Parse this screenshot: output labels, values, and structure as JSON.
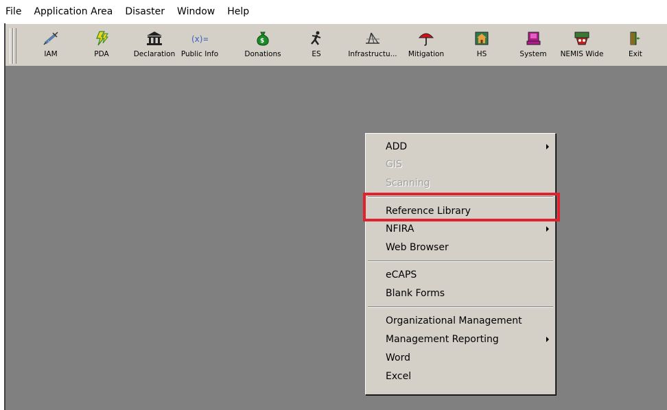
{
  "menubar": {
    "items": [
      "File",
      "Application Area",
      "Disaster",
      "Window",
      "Help"
    ]
  },
  "toolbar": {
    "buttons": [
      {
        "label": "IAM",
        "icon": "syringe-icon",
        "color": "#6a8cb0"
      },
      {
        "label": "PDA",
        "icon": "lightning-icon",
        "color": "#2e8b1e"
      },
      {
        "label": "Declaration",
        "icon": "building-icon",
        "color": "#222222"
      },
      {
        "label": "Public Info",
        "icon": "formula-icon",
        "color": "#3a60c0"
      },
      {
        "label": "Donations",
        "icon": "money-bag-icon",
        "color": "#1d8a2a"
      },
      {
        "label": "ES",
        "icon": "running-person-icon",
        "color": "#222222"
      },
      {
        "label": "Infrastructu...",
        "icon": "bridge-icon",
        "color": "#333333"
      },
      {
        "label": "Mitigation",
        "icon": "umbrella-icon",
        "color": "#d0101a"
      },
      {
        "label": "HS",
        "icon": "house-icon",
        "color": "#2d7a4a"
      },
      {
        "label": "System",
        "icon": "computer-icon",
        "color": "#b01a8a"
      },
      {
        "label": "NEMIS Wide",
        "icon": "nemis-icon",
        "color": "#3a7a30"
      },
      {
        "label": "Exit",
        "icon": "exit-door-icon",
        "color": "#3a8a20"
      }
    ]
  },
  "context_menu": {
    "items": [
      {
        "label": "ADD",
        "enabled": true,
        "submenu": true
      },
      {
        "label": "GIS",
        "enabled": false,
        "submenu": false
      },
      {
        "label": "Scanning",
        "enabled": false,
        "submenu": false
      },
      {
        "label": "Reference Library",
        "enabled": true,
        "submenu": false,
        "highlighted": true
      },
      {
        "label": "NFIRA",
        "enabled": true,
        "submenu": true
      },
      {
        "label": "Web Browser",
        "enabled": true,
        "submenu": false
      },
      {
        "label": "eCAPS",
        "enabled": true,
        "submenu": false
      },
      {
        "label": "Blank Forms",
        "enabled": true,
        "submenu": false
      },
      {
        "label": "Organizational Management",
        "enabled": true,
        "submenu": false
      },
      {
        "label": "Management Reporting",
        "enabled": true,
        "submenu": true
      },
      {
        "label": "Word",
        "enabled": true,
        "submenu": false
      },
      {
        "label": "Excel",
        "enabled": true,
        "submenu": false
      }
    ]
  },
  "colors": {
    "workspace": "#808080",
    "toolbar": "#d4d0c8",
    "highlight_border": "#e0212e"
  }
}
